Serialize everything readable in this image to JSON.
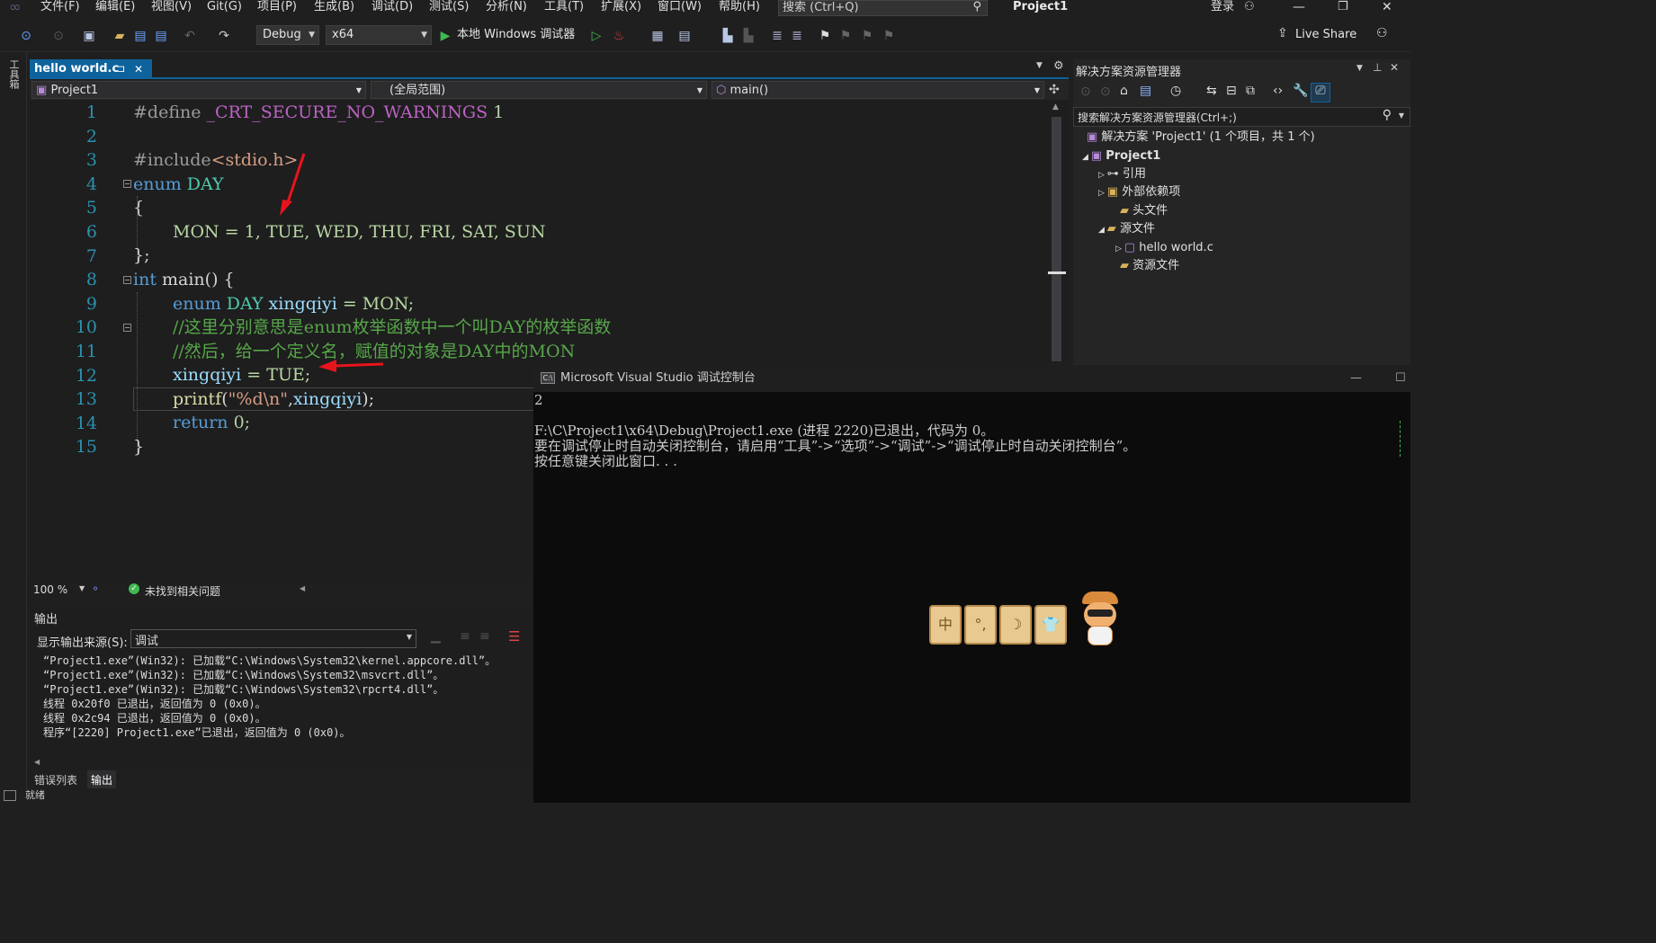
{
  "menu": [
    "文件(F)",
    "编辑(E)",
    "视图(V)",
    "Git(G)",
    "项目(P)",
    "生成(B)",
    "调试(D)",
    "测试(S)",
    "分析(N)",
    "工具(T)",
    "扩展(X)",
    "窗口(W)",
    "帮助(H)"
  ],
  "search_placeholder": "搜索 (Ctrl+Q)",
  "project_title": "Project1",
  "login": "登录",
  "toolbar": {
    "config": "Debug",
    "platform": "x64",
    "run_label": "本地 Windows 调试器",
    "live_share": "Live Share"
  },
  "left_tool_label": "工具箱",
  "tab": {
    "name": "hello world.c",
    "pin": "⊐",
    "close": "✕"
  },
  "navbar": {
    "project": "Project1",
    "scope": "(全局范围)",
    "func": "main()"
  },
  "lines": [
    "1",
    "2",
    "3",
    "4",
    "5",
    "6",
    "7",
    "8",
    "9",
    "10",
    "11",
    "12",
    "13",
    "14",
    "15"
  ],
  "code": {
    "l1a": "#define ",
    "l1b": "_CRT_SECURE_NO_WARNINGS",
    "l1c": " 1",
    "l3a": "#include",
    "l3b": "<stdio.h>",
    "l4a": "enum",
    "l4b": " DAY",
    "l5": "{",
    "l6": "MON = 1, TUE, WED, THU, FRI, SAT, SUN",
    "l7": "};",
    "l8a": "int",
    "l8b": " main() {",
    "l9a": "enum",
    "l9b": " DAY",
    "l9c": " xingqiyi",
    "l9d": " = MON;",
    "l10": "//这里分别意思是enum枚举函数中一个叫DAY的枚举函数",
    "l11": "//然后，给一个定义名，赋值的对象是DAY中的MON",
    "l12a": "xingqiyi",
    "l12b": " = TUE;",
    "l13a": "printf",
    "l13b": "(",
    "l13c": "\"%d\\n\"",
    "l13d": ",",
    "l13e": "xingqiyi",
    "l13f": ");",
    "l14a": "return",
    "l14b": " 0;",
    "l15": "}"
  },
  "status": {
    "zoom": "100 %",
    "issues": "未找到相关问题"
  },
  "output": {
    "title": "输出",
    "source_label": "显示输出来源(S):",
    "source_value": "调试",
    "lines": [
      "“Project1.exe”(Win32): 已加载“C:\\Windows\\System32\\kernel.appcore.dll”。",
      "“Project1.exe”(Win32): 已加载“C:\\Windows\\System32\\msvcrt.dll”。",
      "“Project1.exe”(Win32): 已加载“C:\\Windows\\System32\\rpcrt4.dll”。",
      "线程 0x20f0 已退出，返回值为 0 (0x0)。",
      "线程 0x2c94 已退出，返回值为 0 (0x0)。",
      "程序“[2220] Project1.exe”已退出，返回值为 0 (0x0)。"
    ]
  },
  "bottom_tabs": [
    "错误列表",
    "输出"
  ],
  "footer_text": "就绪",
  "solution_explorer": {
    "title": "解决方案资源管理器",
    "search": "搜索解决方案资源管理器(Ctrl+;)",
    "items": [
      "解决方案 'Project1' (1 个项目，共 1 个)",
      "Project1",
      "引用",
      "外部依赖项",
      "头文件",
      "源文件",
      "hello world.c",
      "资源文件"
    ]
  },
  "console": {
    "title": "Microsoft Visual Studio 调试控制台",
    "lines": [
      "2",
      "",
      "F:\\C\\Project1\\x64\\Debug\\Project1.exe (进程 2220)已退出，代码为 0。",
      "要在调试停止时自动关闭控制台，请启用“工具”->“选项”->“调试”->“调试停止时自动关闭控制台”。",
      "按任意键关闭此窗口. . ."
    ],
    "badges": [
      "中",
      "°,",
      "☽",
      "👕"
    ]
  }
}
